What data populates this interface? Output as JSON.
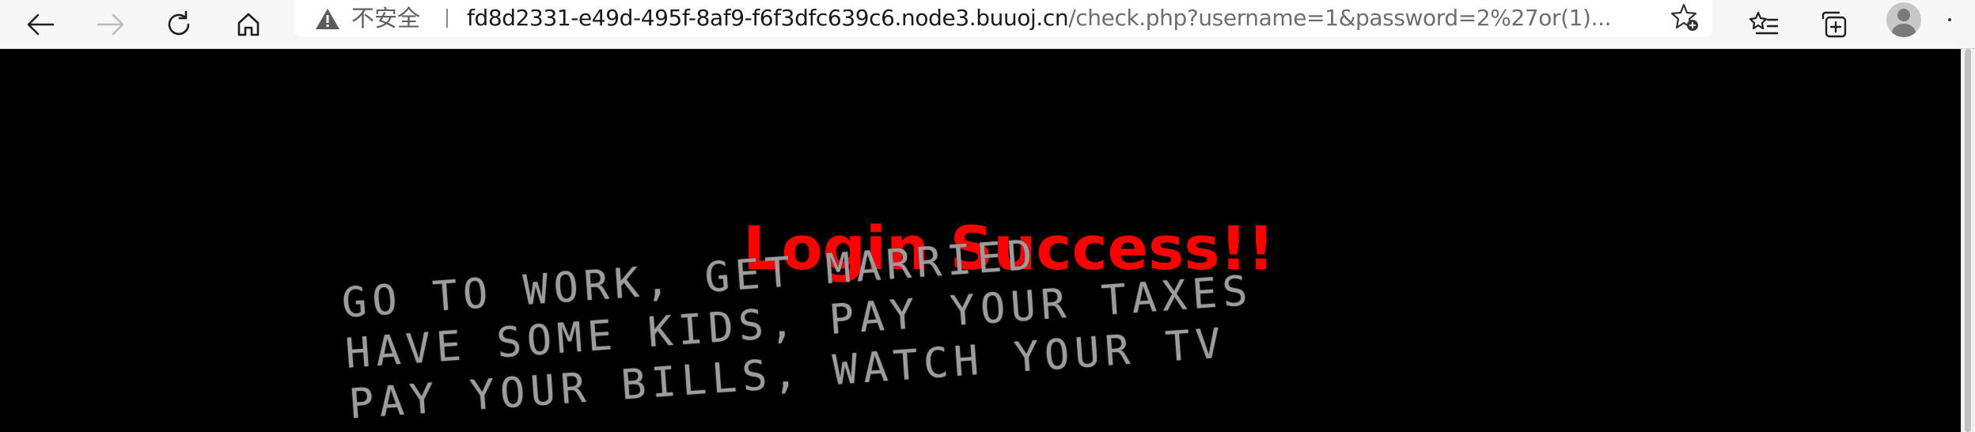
{
  "browser": {
    "nav": {
      "back_icon": "arrow-left-icon",
      "forward_icon": "arrow-right-icon",
      "refresh_icon": "refresh-icon",
      "home_icon": "home-icon"
    },
    "addressbar": {
      "security_icon": "warning-triangle-icon",
      "security_label": "不安全",
      "url_host": "fd8d2331-e49d-495f-8af9-f6f3dfc639c6.node3.buuoj.cn",
      "url_path": "/check.php?username=1&password=2%27or(1)...",
      "favorite_icon": "star-add-icon"
    },
    "toolbar_right": {
      "favorites_icon": "favorites-list-icon",
      "collections_icon": "collections-icon",
      "profile_icon": "avatar-icon",
      "more_icon": "more-icon"
    }
  },
  "page": {
    "heading": "Login Success!!",
    "background_text": [
      "GO TO WORK, GET MARRIED",
      "HAVE SOME KIDS, PAY YOUR TAXES",
      "PAY YOUR BILLS, WATCH YOUR TV"
    ]
  },
  "colors": {
    "heading": "#ff0000",
    "page_background": "#000000",
    "toolbar_background": "#f7f7f7"
  }
}
